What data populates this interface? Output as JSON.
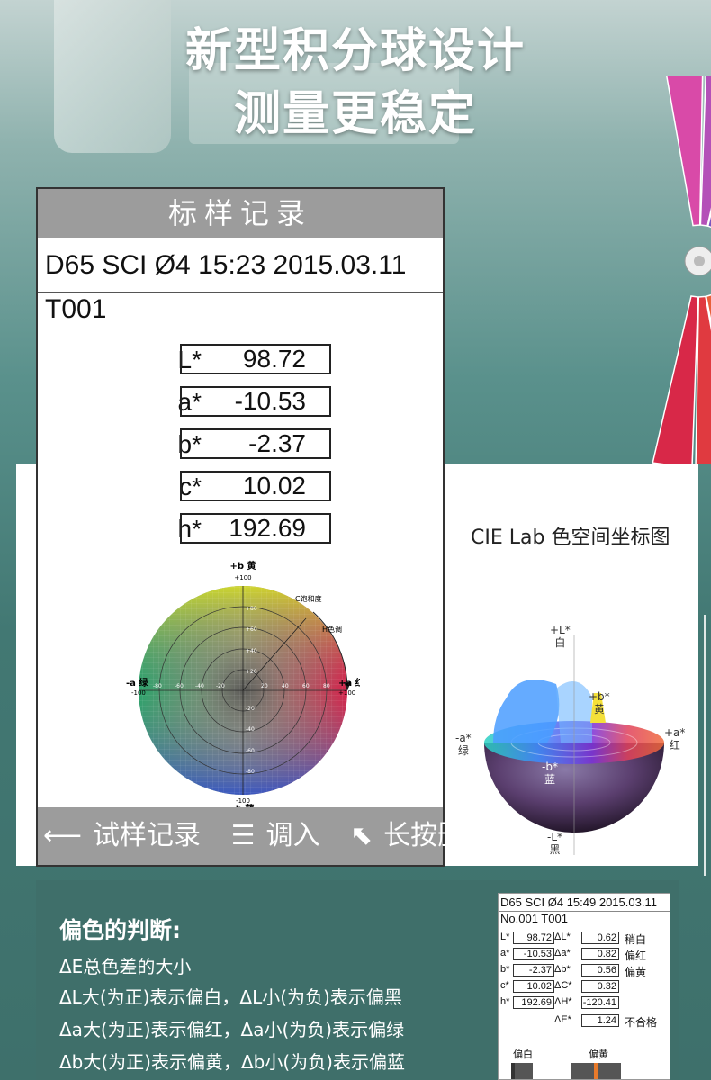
{
  "headline": {
    "line1": "新型积分球设计",
    "line2": "测量更稳定"
  },
  "device": {
    "title": "标样记录",
    "info": "D65 SCI Ø4 15:23 2015.03.11",
    "id": "T001",
    "rows": [
      {
        "label": "L*",
        "value": "98.72"
      },
      {
        "label": "a*",
        "value": "-10.53"
      },
      {
        "label": "b*",
        "value": "-2.37"
      },
      {
        "label": "c*",
        "value": "10.02"
      },
      {
        "label": "h*",
        "value": "192.69"
      }
    ],
    "wheel": {
      "top": "+b 黄",
      "bottom": "-b 蓝",
      "left": "-a 绿",
      "right": "+a 红",
      "top_num": "+100",
      "bottom_num": "-100",
      "left_num": "-100",
      "right_num": "+100",
      "chroma_label": "C饱和度",
      "hue_label": "H色调",
      "ticks_pos": [
        "+80",
        "+60",
        "+40",
        "+20"
      ],
      "ticks_neg": [
        "-20",
        "-40",
        "-60",
        "-80"
      ],
      "h_ticks_neg": [
        "-80",
        "-60",
        "-40",
        "-20"
      ],
      "h_ticks_pos": [
        "20",
        "40",
        "60",
        "80"
      ]
    },
    "footer": {
      "record": "试样记录",
      "load": "调入",
      "delete": "长按删除"
    }
  },
  "cie": {
    "title": "CIE Lab 色空间坐标图",
    "top": "+L*",
    "top_cn": "白",
    "bottom": "-L*",
    "bottom_cn": "黑",
    "left": "-a*",
    "left_cn": "绿",
    "right": "+a*",
    "right_cn": "红",
    "b_pos": "+b*",
    "b_pos_cn": "黄",
    "b_neg": "-b*",
    "b_neg_cn": "蓝"
  },
  "judge": {
    "title": "偏色的判断:",
    "lines": [
      "ΔE总色差的大小",
      "ΔL大(为正)表示偏白，ΔL小(为负)表示偏黑",
      "Δa大(为正)表示偏红，Δa小(为负)表示偏绿",
      "Δb大(为正)表示偏黄，Δb小(为负)表示偏蓝"
    ]
  },
  "mini": {
    "head": "D65 SCI Ø4 15:49 2015.03.11",
    "sub": "No.001  T001",
    "rows": [
      {
        "l": "L*",
        "v": "98.72",
        "dl": "ΔL*",
        "dv": "0.62",
        "note": "稍白"
      },
      {
        "l": "a*",
        "v": "-10.53",
        "dl": "Δa*",
        "dv": "0.82",
        "note": "偏红"
      },
      {
        "l": "b*",
        "v": "-2.37",
        "dl": "Δb*",
        "dv": "0.56",
        "note": "偏黄"
      },
      {
        "l": "c*",
        "v": "10.02",
        "dl": "ΔC*",
        "dv": "0.32",
        "note": ""
      },
      {
        "l": "h*",
        "v": "192.69",
        "dl": "ΔH*",
        "dv": "-120.41",
        "note": ""
      }
    ],
    "de_label": "ΔE*",
    "de_value": "1.24",
    "de_note": "不合格",
    "bar_left": "偏白",
    "bar_right": "偏黄"
  },
  "colors": {
    "bg": "#427873",
    "panel_gray": "#9c9c9c",
    "judge_bg": "#3f6f6a"
  }
}
